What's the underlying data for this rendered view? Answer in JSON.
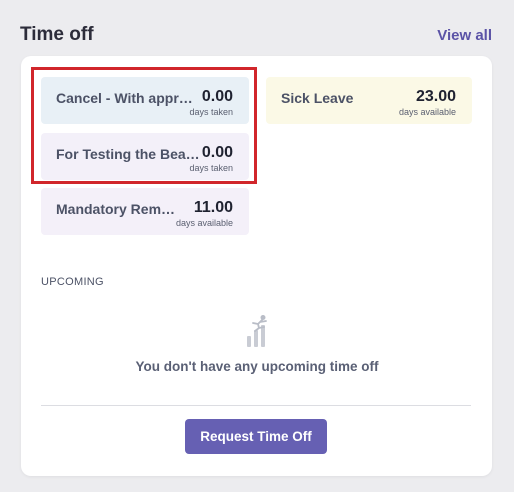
{
  "header": {
    "title": "Time off",
    "view_all": "View all"
  },
  "balances": [
    {
      "name": "Cancel - With appr…",
      "value": "0.00",
      "unit": "days taken",
      "bg": "#e8f0f6"
    },
    {
      "name": "Sick Leave",
      "value": "23.00",
      "unit": "days available",
      "bg": "#fbf9e6"
    },
    {
      "name": "For Testing the Bea…",
      "value": "0.00",
      "unit": "days taken",
      "bg": "#f3f0f9"
    },
    {
      "name": "Mandatory Rem…",
      "value": "11.00",
      "unit": "days available",
      "bg": "#f4f0f9"
    }
  ],
  "upcoming": {
    "label": "UPCOMING",
    "empty_text": "You don't have any upcoming time off",
    "empty_icon": "jumping-figure-chart-icon"
  },
  "actions": {
    "request_label": "Request Time Off"
  },
  "colors": {
    "accent": "#6660b3",
    "link": "#5b53a6",
    "highlight": "#d1262b"
  }
}
